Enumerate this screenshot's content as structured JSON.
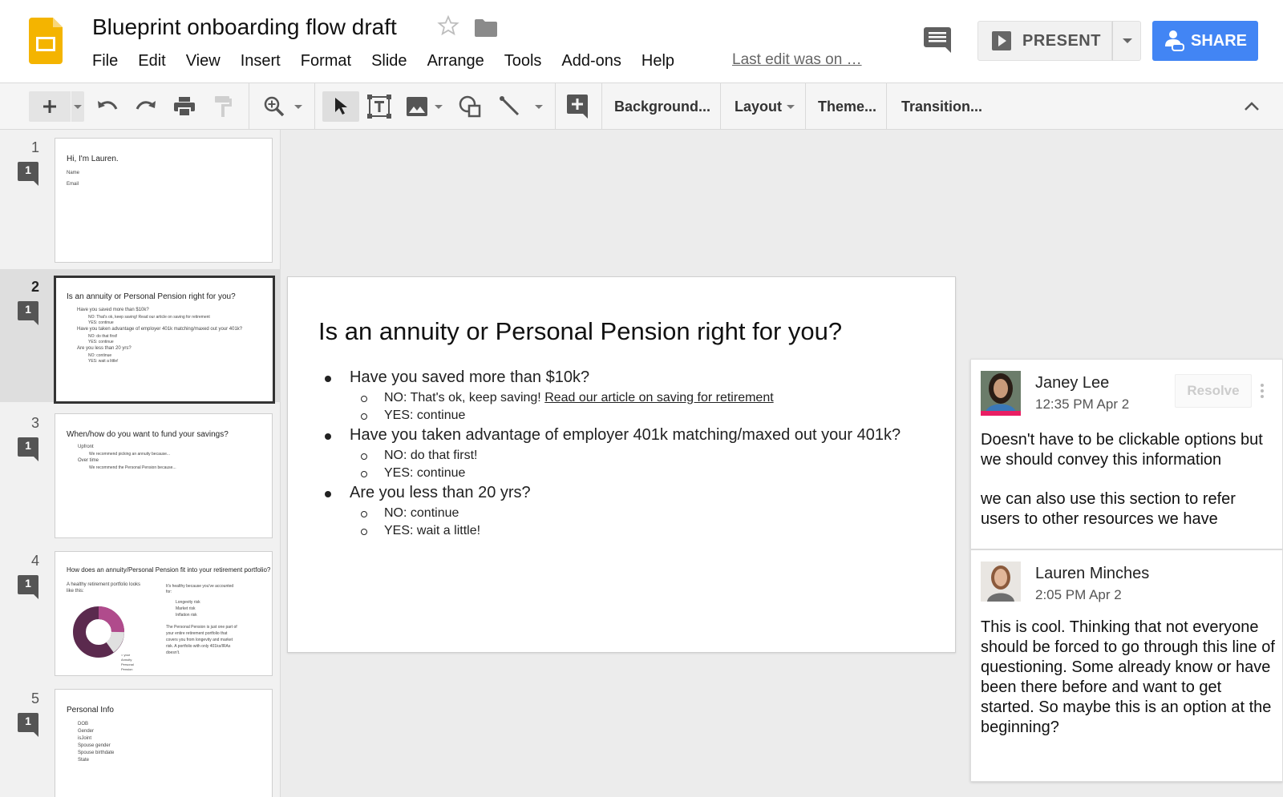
{
  "header": {
    "doc_title": "Blueprint onboarding flow draft",
    "menu": [
      "File",
      "Edit",
      "View",
      "Insert",
      "Format",
      "Slide",
      "Arrange",
      "Tools",
      "Add-ons",
      "Help"
    ],
    "last_edit": "Last edit was on …",
    "present_label": "PRESENT",
    "share_label": "SHARE",
    "brand_color": "#f4b400",
    "share_color": "#4285f4"
  },
  "toolbar": {
    "background_label": "Background...",
    "layout_label": "Layout",
    "theme_label": "Theme...",
    "transition_label": "Transition...",
    "icons": [
      "plus-icon",
      "undo-icon",
      "redo-icon",
      "print-icon",
      "paint-format-icon",
      "zoom-icon",
      "cursor-icon",
      "text-box-icon",
      "image-icon",
      "shape-icon",
      "line-icon",
      "add-comment-icon",
      "collapse-icon"
    ]
  },
  "filmstrip": {
    "slides": [
      {
        "num": "1",
        "comments": "1",
        "title": "Hi, I'm Lauren.",
        "lines": [
          "Name",
          "Email"
        ]
      },
      {
        "num": "2",
        "comments": "1",
        "title": "Is an annuity or Personal Pension right for you?",
        "lines": [
          "Have you saved more than $10k?",
          "NO: That's ok, keep saving! Read our article on saving for retirement",
          "YES: continue",
          "Have you taken advantage of employer 401k matching/maxed out your 401k?",
          "NO: do that first!",
          "YES: continue",
          "Are you less than 20 yrs?",
          "NO: continue",
          "YES: wait a little!"
        ]
      },
      {
        "num": "3",
        "comments": "1",
        "title": "When/how do you want to fund your savings?",
        "lines": [
          "Upfront",
          "We recommend picking an annuity because...",
          "Over time",
          "We recommend the Personal Pension because..."
        ]
      },
      {
        "num": "4",
        "comments": "1",
        "title": "How does an annuity/Personal Pension fit into your retirement portfolio?",
        "lines": [
          "A healthy retirement portfolio looks",
          "like this:",
          "It's healthy because you've accounted",
          "for:",
          "Longevity risk",
          "Market risk",
          "Inflation risk",
          "The Personal Pension is just one part of",
          "your entire retirement portfolio that",
          "covers you from longevity and market",
          "risk. A portfolio with only 401ks/IRAs",
          "doesn't.",
          "= your",
          "Annuity",
          "Personal",
          "Pension"
        ]
      },
      {
        "num": "5",
        "comments": "1",
        "title": "Personal Info",
        "lines": [
          "DOB",
          "Gender",
          "isJoint",
          "Spouse gender",
          "Spouse birthdate",
          "State"
        ]
      }
    ]
  },
  "slide": {
    "title": "Is an annuity or Personal Pension right for you?",
    "q1": "Have you saved more than $10k?",
    "q1_no_prefix": "NO: That's ok, keep saving! ",
    "q1_no_link": "Read our article on saving for retirement",
    "q1_yes": "YES: continue",
    "q2": "Have you taken advantage of employer 401k matching/maxed out your 401k?",
    "q2_no": "NO: do that first!",
    "q2_yes": "YES: continue",
    "q3": "Are you less than 20 yrs?",
    "q3_no": "NO: continue",
    "q3_yes": "YES: wait a little!"
  },
  "comments": [
    {
      "author": "Janey Lee",
      "time": "12:35 PM Apr 2",
      "resolve_label": "Resolve",
      "body_p1": "Doesn't have to be clickable options but we should convey this information",
      "body_p2": "we can also use this section to refer users to other resources we have",
      "highlight_color": "#e91e63"
    },
    {
      "author": "Lauren Minches",
      "time": "2:05 PM Apr 2",
      "body_p1": "This is cool. Thinking that not everyone should be forced to go through this line of questioning. Some already know or have been there before and want to get started. So maybe this is an option at the beginning?"
    }
  ]
}
